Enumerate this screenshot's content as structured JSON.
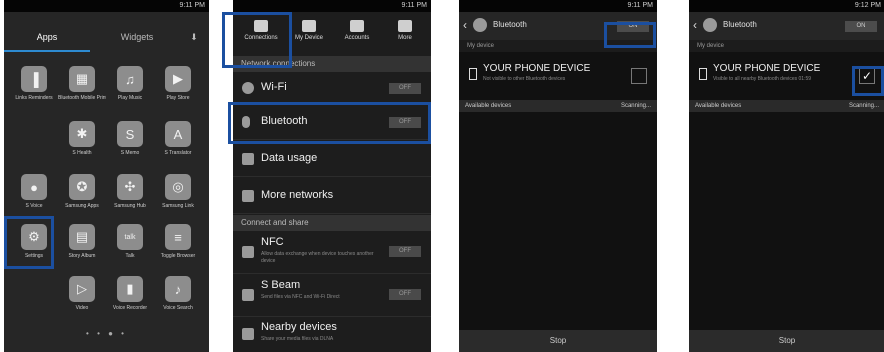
{
  "status": {
    "time1": "9:11 PM",
    "time2": "9:11 PM",
    "time3": "9:11 PM",
    "time4": "9:12 PM"
  },
  "phone1": {
    "tabs": [
      "Apps",
      "Widgets"
    ],
    "apps": [
      {
        "label": "Links Reminders",
        "icon": "▐"
      },
      {
        "label": "Bluetooth Mobile Print",
        "icon": "▦"
      },
      {
        "label": "Play Music",
        "icon": "♫"
      },
      {
        "label": "Play Store",
        "icon": "▶"
      },
      {
        "label": "S Health",
        "icon": "✱"
      },
      {
        "label": "S Memo",
        "icon": "S"
      },
      {
        "label": "S Translator",
        "icon": "A"
      },
      {
        "label": "S Voice",
        "icon": "●"
      },
      {
        "label": "Samsung Apps",
        "icon": "✪"
      },
      {
        "label": "Samsung Hub",
        "icon": "✣"
      },
      {
        "label": "Samsung Link",
        "icon": "◎"
      },
      {
        "label": "Settings",
        "icon": "⚙"
      },
      {
        "label": "Story Album",
        "icon": "▤"
      },
      {
        "label": "Talk",
        "icon": "talk"
      },
      {
        "label": "Toggle Browser",
        "icon": "≡"
      },
      {
        "label": "Video",
        "icon": "▷"
      },
      {
        "label": "Voice Recorder",
        "icon": "▮"
      },
      {
        "label": "Voice Search",
        "icon": "♪"
      }
    ],
    "page_dots": "• • ● •"
  },
  "phone2": {
    "tabs": [
      "Connections",
      "My Device",
      "Accounts",
      "More"
    ],
    "section1": "Network connections",
    "wifi": {
      "label": "Wi-Fi",
      "toggle": "OFF"
    },
    "bluetooth": {
      "label": "Bluetooth",
      "toggle": "OFF"
    },
    "data_usage": {
      "label": "Data usage"
    },
    "more_networks": {
      "label": "More networks"
    },
    "section2": "Connect and share",
    "nfc": {
      "label": "NFC",
      "sub": "Allow data exchange when device touches another device",
      "toggle": "OFF"
    },
    "sbeam": {
      "label": "S Beam",
      "sub": "Send files via NFC and Wi-Fi Direct",
      "toggle": "OFF"
    },
    "nearby": {
      "label": "Nearby devices",
      "sub": "Share your media files via DLNA"
    }
  },
  "phone3": {
    "title": "Bluetooth",
    "toggle": "ON",
    "my_device_header": "My device",
    "device_name": "YOUR PHONE DEVICE",
    "device_sub": "Not visible to other Bluetooth devices",
    "available": "Available devices",
    "scanning": "Scanning...",
    "stop": "Stop"
  },
  "phone4": {
    "title": "Bluetooth",
    "toggle": "ON",
    "my_device_header": "My device",
    "device_name": "YOUR PHONE DEVICE",
    "device_sub": "Visible to all nearby Bluetooth devices 01:59",
    "check": "✓",
    "available": "Available devices",
    "scanning": "Scanning...",
    "stop": "Stop"
  }
}
